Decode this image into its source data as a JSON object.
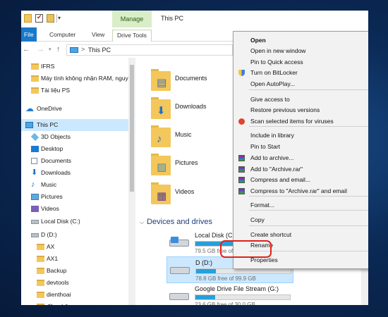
{
  "window": {
    "title": "This PC",
    "context_tab": "Manage"
  },
  "ribbon": {
    "tabs": [
      "File",
      "Computer",
      "View",
      "Drive Tools"
    ]
  },
  "address": {
    "crumb_separator": ">",
    "crumb": "This PC"
  },
  "nav_pane": {
    "items": [
      {
        "label": "IFRS",
        "icon": "folder-icon"
      },
      {
        "label": "Máy tính không nhận RAM, nguy",
        "icon": "folder-icon"
      },
      {
        "label": "Tài liệu PS",
        "icon": "folder-icon"
      },
      {
        "label": "OneDrive",
        "icon": "cloud-icon"
      },
      {
        "label": "This PC",
        "icon": "computer-icon",
        "selected": true
      },
      {
        "label": "3D Objects",
        "icon": "cube-icon"
      },
      {
        "label": "Desktop",
        "icon": "desktop-icon"
      },
      {
        "label": "Documents",
        "icon": "document-icon"
      },
      {
        "label": "Downloads",
        "icon": "download-icon"
      },
      {
        "label": "Music",
        "icon": "music-icon"
      },
      {
        "label": "Pictures",
        "icon": "picture-icon"
      },
      {
        "label": "Videos",
        "icon": "video-icon"
      },
      {
        "label": "Local Disk (C:)",
        "icon": "drive-icon"
      },
      {
        "label": "D (D:)",
        "icon": "drive-icon"
      },
      {
        "label": "AX",
        "icon": "folder-icon"
      },
      {
        "label": "AX1",
        "icon": "folder-icon"
      },
      {
        "label": "Backup",
        "icon": "folder-icon"
      },
      {
        "label": "devtools",
        "icon": "folder-icon"
      },
      {
        "label": "dienthoai",
        "icon": "folder-icon"
      },
      {
        "label": "đồng bộ",
        "icon": "folder-icon"
      }
    ]
  },
  "content": {
    "folders": [
      {
        "label": "Documents",
        "icon": "documents-folder-icon"
      },
      {
        "label": "Downloads",
        "icon": "downloads-folder-icon"
      },
      {
        "label": "Music",
        "icon": "music-folder-icon"
      },
      {
        "label": "Pictures",
        "icon": "pictures-folder-icon"
      },
      {
        "label": "Videos",
        "icon": "videos-folder-icon"
      }
    ],
    "devices_header": "Devices and drives",
    "drives": [
      {
        "name": "Local Disk (C:)",
        "free": "79.5 GB free of",
        "used_fraction": 0.62
      },
      {
        "name": "D (D:)",
        "free": "78.8 GB free of 99.9 GB",
        "used_fraction": 0.21,
        "selected": true
      },
      {
        "name": "Google Drive File Stream (G:)",
        "free": "23.6 GB free of 30.0 GB",
        "used_fraction": 0.21
      }
    ]
  },
  "context_menu": {
    "items": [
      {
        "label": "Open",
        "bold": true
      },
      {
        "label": "Open in new window"
      },
      {
        "label": "Pin to Quick access"
      },
      {
        "label": "Turn on BitLocker",
        "icon": "shield-icon"
      },
      {
        "label": "Open AutoPlay..."
      },
      {
        "label": "Give access to",
        "submenu": true
      },
      {
        "label": "Restore previous versions"
      },
      {
        "label": "Scan selected items for viruses",
        "icon": "scan-icon"
      },
      {
        "label": "Include in library",
        "submenu": true
      },
      {
        "label": "Pin to Start"
      },
      {
        "label": "Add to archive...",
        "icon": "winrar-icon"
      },
      {
        "label": "Add to \"Archive.rar\"",
        "icon": "winrar-icon"
      },
      {
        "label": "Compress and email...",
        "icon": "winrar-icon"
      },
      {
        "label": "Compress to \"Archive.rar\" and email",
        "icon": "winrar-icon"
      },
      {
        "label": "Format..."
      },
      {
        "label": "Copy"
      },
      {
        "label": "Create shortcut"
      },
      {
        "label": "Rename"
      },
      {
        "label": "Properties",
        "highlighted": true
      }
    ]
  },
  "colors": {
    "accent": "#1979ca",
    "selection": "#cce8ff",
    "highlight_ring": "#e0201c",
    "manage_tab": "#d9eec8"
  }
}
